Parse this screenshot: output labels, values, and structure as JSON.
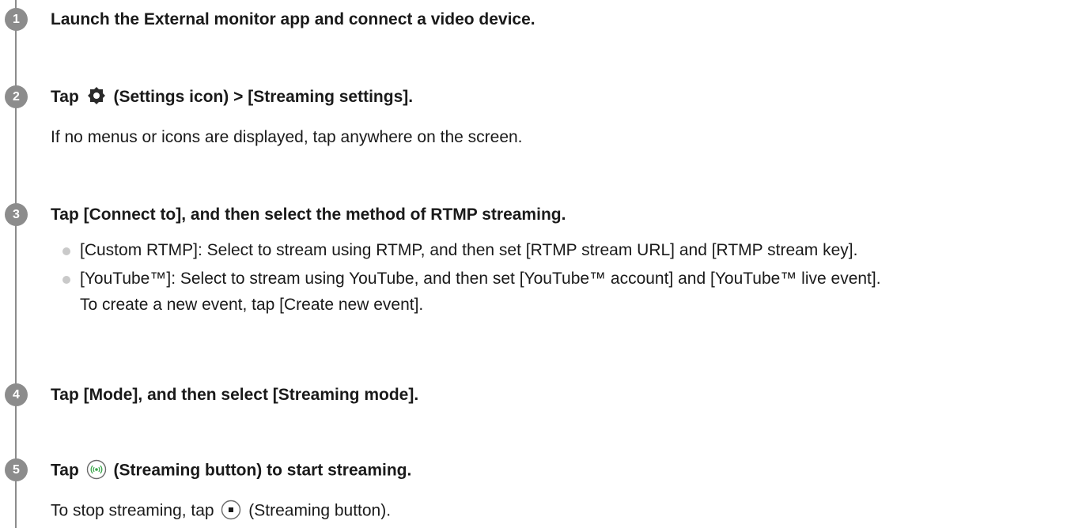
{
  "steps": [
    {
      "number": "1",
      "title": "Launch the External monitor app and connect a video device."
    },
    {
      "number": "2",
      "title_prefix": "Tap",
      "title_suffix": "(Settings icon) > [Streaming settings].",
      "icon": "gear-icon",
      "note": "If no menus or icons are displayed, tap anywhere on the screen."
    },
    {
      "number": "3",
      "title": "Tap [Connect to], and then select the method of RTMP streaming.",
      "bullets": [
        {
          "line1": "[Custom RTMP]: Select to stream using RTMP, and then set [RTMP stream URL] and [RTMP stream key]."
        },
        {
          "line1": "[YouTube™]: Select to stream using YouTube, and then set [YouTube™ account] and [YouTube™ live event].",
          "line2": "To create a new event, tap [Create new event]."
        }
      ]
    },
    {
      "number": "4",
      "title": "Tap [Mode], and then select [Streaming mode]."
    },
    {
      "number": "5",
      "title_prefix": "Tap",
      "title_suffix": "(Streaming button) to start streaming.",
      "icon": "streaming-start-icon",
      "note_prefix": "To stop streaming, tap",
      "note_suffix": "(Streaming button).",
      "note_icon": "streaming-stop-icon"
    }
  ],
  "colors": {
    "step_badge": "#8c8c8c",
    "text": "#1a1a1a",
    "bullet_dot": "#c9c9c9",
    "streaming_green": "#3aa64a"
  }
}
